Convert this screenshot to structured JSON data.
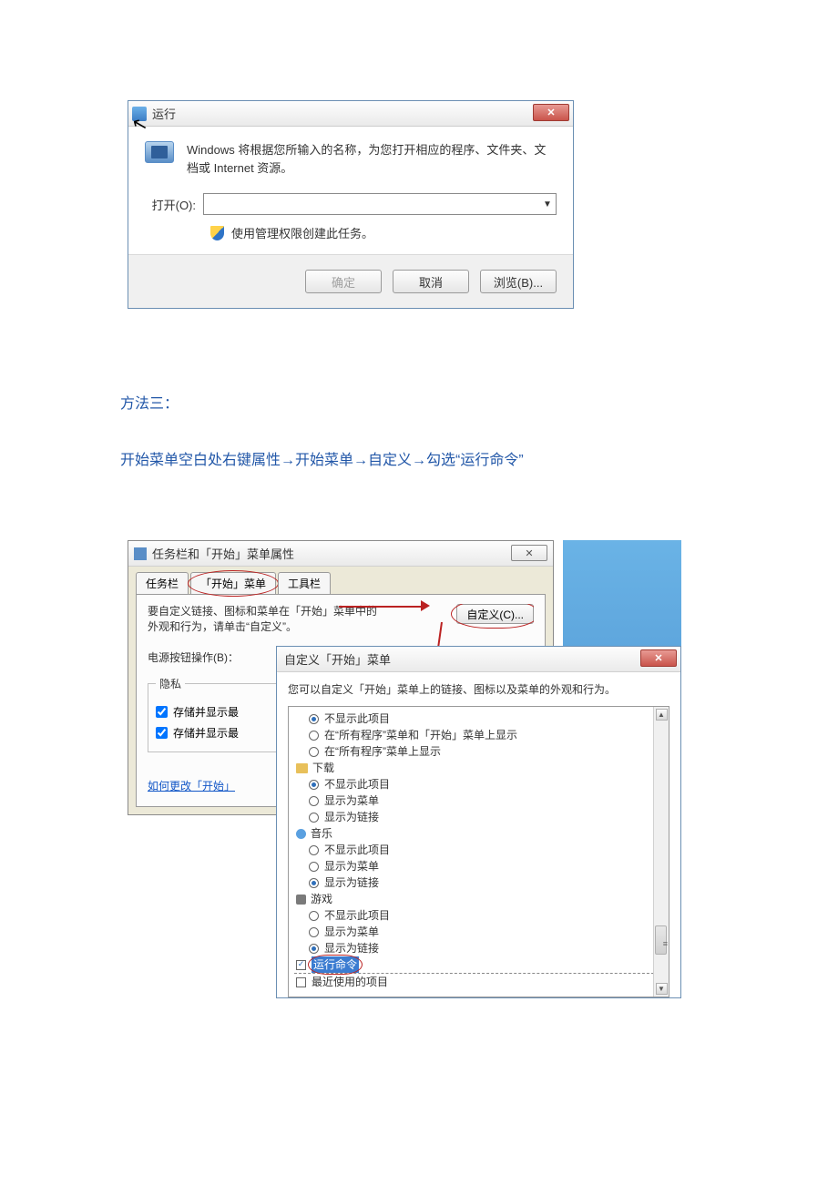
{
  "run_dialog": {
    "title": "运行",
    "description": "Windows 将根据您所输入的名称，为您打开相应的程序、文件夹、文档或 Internet 资源。",
    "open_label": "打开(O):",
    "input_value": "",
    "admin_text": "使用管理权限创建此任务。",
    "ok_btn": "确定",
    "cancel_btn": "取消",
    "browse_btn": "浏览(B)..."
  },
  "text": {
    "method_title": "方法三：",
    "method_desc": "开始菜单空白处右键属性→开始菜单→自定义→勾选“运行命令”"
  },
  "props_dialog": {
    "title": "任务栏和「开始」菜单属性",
    "tabs": {
      "taskbar": "任务栏",
      "startmenu": "「开始」菜单",
      "toolbars": "工具栏"
    },
    "body_text": "要自定义链接、图标和菜单在「开始」菜单中的外观和行为，请单击“自定义”。",
    "customize_btn": "自定义(C)...",
    "power_label": "电源按钮操作(B)：",
    "privacy_legend": "隐私",
    "check1": "存储并显示最",
    "check2": "存储并显示最",
    "howto_link": "如何更改「开始」"
  },
  "customize_dialog": {
    "title": "自定义「开始」菜单",
    "desc": "您可以自定义「开始」菜单上的链接、图标以及菜单的外观和行为。",
    "tree": {
      "g0_r0": "不显示此项目",
      "g0_r1": "在“所有程序”菜单和「开始」菜单上显示",
      "g0_r2": "在“所有程序”菜单上显示",
      "download": "下载",
      "g1_r0": "不显示此项目",
      "g1_r1": "显示为菜单",
      "g1_r2": "显示为链接",
      "music": "音乐",
      "g2_r0": "不显示此项目",
      "g2_r1": "显示为菜单",
      "g2_r2": "显示为链接",
      "games": "游戏",
      "g3_r0": "不显示此项目",
      "g3_r1": "显示为菜单",
      "g3_r2": "显示为链接",
      "run_cmd": "运行命令",
      "recent": "最近使用的项目"
    }
  }
}
